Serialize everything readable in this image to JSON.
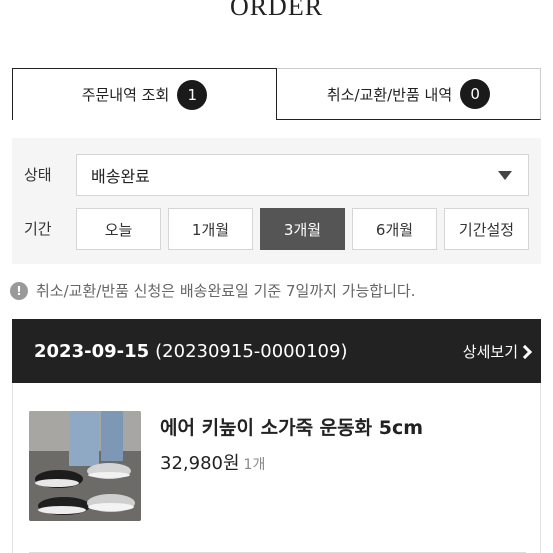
{
  "page": {
    "title": "ORDER"
  },
  "tabs": [
    {
      "label": "주문내역 조회",
      "count": "1",
      "active": true
    },
    {
      "label": "취소/교환/반품 내역",
      "count": "0",
      "active": false
    }
  ],
  "filter": {
    "status_label": "상태",
    "status_value": "배송완료",
    "period_label": "기간",
    "period_options": [
      "오늘",
      "1개월",
      "3개월",
      "6개월",
      "기간설정"
    ],
    "selected_period": "3개월"
  },
  "notice": {
    "text": "취소/교환/반품 신청은 배송완료일 기준 7일까지 가능합니다."
  },
  "order": {
    "date": "2023-09-15",
    "number": "(20230915-0000109)",
    "detail_label": "상세보기",
    "item": {
      "name": "에어 키높이 소가죽 운동화 5cm",
      "price": "32,980원",
      "quantity": "1개"
    }
  },
  "colors": {
    "header_bg": "#222222",
    "selected_btn": "#555555",
    "filter_bg": "#f5f5f5"
  }
}
